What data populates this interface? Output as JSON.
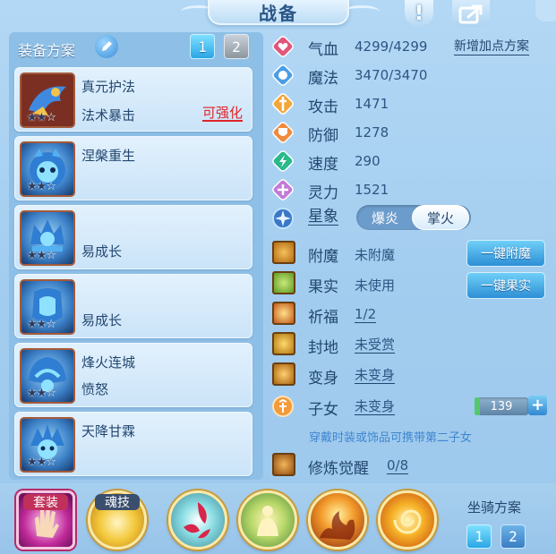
{
  "header": {
    "title": "战备",
    "info_glyph": "!"
  },
  "equipment_scheme": {
    "label": "装备方案",
    "pages": [
      "1",
      "2"
    ],
    "active_page": "1"
  },
  "equipment": [
    {
      "name": "真元护法",
      "subtitle": "法术暴击",
      "tag": "可强化",
      "stars_filled": 2,
      "stars_total": 3,
      "icon": "blue-dragon-talisman-icon"
    },
    {
      "name": "涅槃重生",
      "subtitle": "",
      "tag": "",
      "stars_filled": 2,
      "stars_total": 3,
      "icon": "blue-mask-icon"
    },
    {
      "name": "",
      "subtitle": "易成长",
      "tag": "",
      "stars_filled": 2,
      "stars_total": 3,
      "icon": "blue-crown-icon"
    },
    {
      "name": "",
      "subtitle": "易成长",
      "tag": "",
      "stars_filled": 2,
      "stars_total": 3,
      "icon": "blue-armor-icon"
    },
    {
      "name": "烽火连城",
      "subtitle": "愤怒",
      "tag": "",
      "stars_filled": 2,
      "stars_total": 3,
      "icon": "blue-helmet-icon"
    },
    {
      "name": "天降甘霖",
      "subtitle": "",
      "tag": "",
      "stars_filled": 2,
      "stars_total": 3,
      "icon": "blue-headdress-icon"
    }
  ],
  "stats": [
    {
      "label": "气血",
      "value": "4299/4299",
      "icon": "heart-icon",
      "color": "#e0577a"
    },
    {
      "label": "魔法",
      "value": "3470/3470",
      "icon": "mana-icon",
      "color": "#4a9ee6"
    },
    {
      "label": "攻击",
      "value": "1471",
      "icon": "attack-icon",
      "color": "#f3a73a"
    },
    {
      "label": "防御",
      "value": "1278",
      "icon": "defense-icon",
      "color": "#f08a3c"
    },
    {
      "label": "速度",
      "value": "290",
      "icon": "speed-icon",
      "color": "#29b98a"
    },
    {
      "label": "灵力",
      "value": "1521",
      "icon": "spirit-icon",
      "color": "#c37ad8"
    }
  ],
  "add_scheme_link": "新增加点方案",
  "xingxiang": {
    "label": "星象",
    "options": [
      "爆炎",
      "掌火"
    ],
    "selected": "掌火"
  },
  "enhancements": [
    {
      "label": "附魔",
      "value": "未附魔",
      "underlined": false,
      "icon": "enchant-icon"
    },
    {
      "label": "果实",
      "value": "未使用",
      "underlined": false,
      "icon": "fruit-icon"
    },
    {
      "label": "祈福",
      "value": "1/2",
      "underlined": true,
      "icon": "blessing-icon"
    },
    {
      "label": "封地",
      "value": "未受赏",
      "underlined": true,
      "icon": "fief-icon"
    },
    {
      "label": "变身",
      "value": "未变身",
      "underlined": true,
      "icon": "transform-icon"
    }
  ],
  "actions": {
    "enchant": "一键附魔",
    "fruit": "一键果实"
  },
  "children": {
    "label": "子女",
    "value": "未变身",
    "count": "139",
    "hint": "穿戴时装或饰品可携带第二子女",
    "icon": "child-icon"
  },
  "cultivation": {
    "label": "修炼觉醒",
    "value": "0/8",
    "icon": "cultivation-icon"
  },
  "bottom_bar": {
    "set_label": "套装",
    "soul_label": "魂技",
    "skills": [
      "wind-blade-skill-icon",
      "golden-buddha-skill-icon",
      "flame-burst-skill-icon",
      "fire-vortex-skill-icon"
    ],
    "mount_label": "坐骑方案",
    "mount_pages": [
      "1",
      "2"
    ]
  },
  "colors": {
    "accent": "#2aa6e6",
    "warning": "#e0242a",
    "text": "#23476f"
  }
}
